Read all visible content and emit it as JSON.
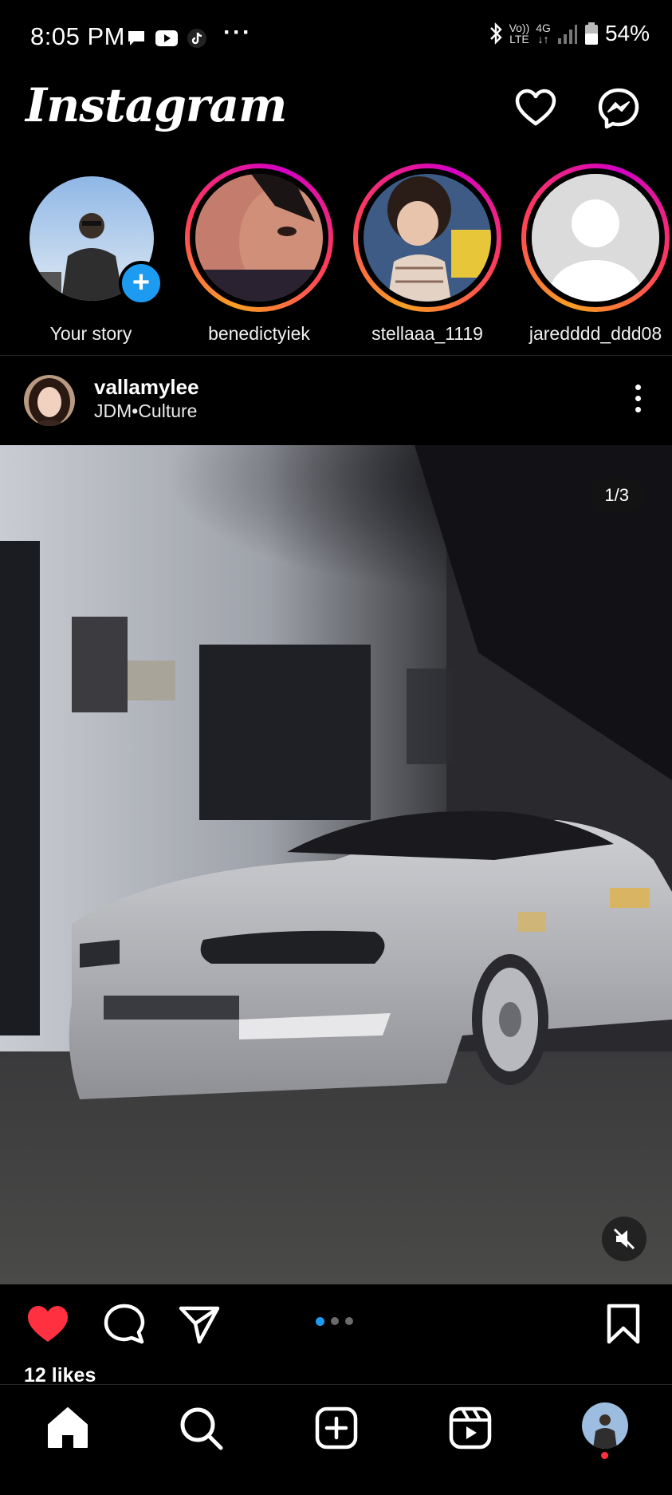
{
  "status_bar": {
    "time": "8:05 PM",
    "battery": "54%",
    "network_top": "Vo))",
    "network_bottom": "LTE",
    "network_type": "4G",
    "icons": [
      "message-bubble-icon",
      "youtube-icon",
      "tiktok-icon",
      "more-dots-icon",
      "bluetooth-icon",
      "signal-icon",
      "battery-icon"
    ]
  },
  "header": {
    "app_name": "Instagram",
    "icons": [
      "heart-icon",
      "messenger-icon"
    ]
  },
  "stories": [
    {
      "username": "Your story",
      "own": true
    },
    {
      "username": "benedictyiek",
      "own": false
    },
    {
      "username": "stellaaa_1119",
      "own": false
    },
    {
      "username": "jaredddd_ddd08",
      "own": false
    }
  ],
  "post": {
    "username": "vallamylee",
    "location": "JDM•Culture",
    "media_counter": "1/3",
    "carousel_position": 1,
    "carousel_total": 3,
    "likes": "12 likes",
    "liked": true
  },
  "nav": {
    "items": [
      "home-icon",
      "search-icon",
      "create-icon",
      "reels-icon",
      "profile-avatar"
    ],
    "notification_dot": true
  },
  "colors": {
    "background": "#000000",
    "accent_blue": "#1d9bf0",
    "like_red": "#ff3040",
    "story_ring": [
      "#f9a023",
      "#ff3a5c",
      "#d300c5"
    ]
  }
}
